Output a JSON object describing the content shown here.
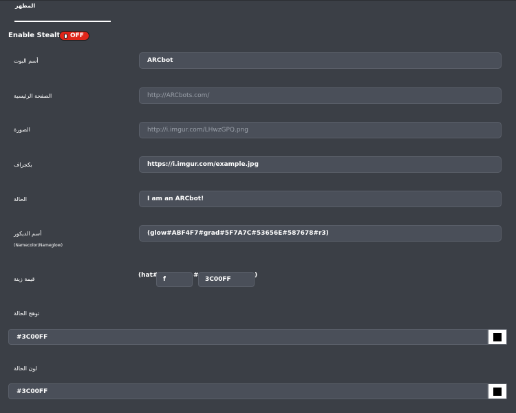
{
  "tabs": [
    {
      "label": "المظهر",
      "active": true
    }
  ],
  "stealth": {
    "label": "Enable Stealth?",
    "state": "OFF",
    "color": "#e0261a"
  },
  "fields": {
    "bot_name": {
      "label": "أسم البوت",
      "value": "ARCbot"
    },
    "homepage": {
      "label": "الصفحة الرئيسية",
      "placeholder": "http://ARCbots.com/"
    },
    "image": {
      "label": "الصورة",
      "placeholder": "http://i.imgur.com/LHwzGPQ.png"
    },
    "background": {
      "label": "بكجراف",
      "value": "https://i.imgur.com/example.jpg"
    },
    "status": {
      "label": "الحالة",
      "value": "I am an ARCbot!"
    },
    "name_decor": {
      "label": "أسم الديكور",
      "sublabel": "(Namecolor/Nameglow)",
      "value": "(glow#ABF4F7#grad#5F7A7C#53656E#587678#r3)"
    },
    "hat": {
      "label": "قيمة زينة",
      "prefix": "(hat#",
      "first_value": "f",
      "separator": "#",
      "second_value": "3C00FF",
      "suffix": ")"
    },
    "status_glow": {
      "label": "توهج الحالة",
      "value": "#3C00FF",
      "swatch": "#000000"
    },
    "status_color": {
      "label": "لون الحالة",
      "value": "#3C00FF",
      "swatch": "#000000"
    }
  }
}
